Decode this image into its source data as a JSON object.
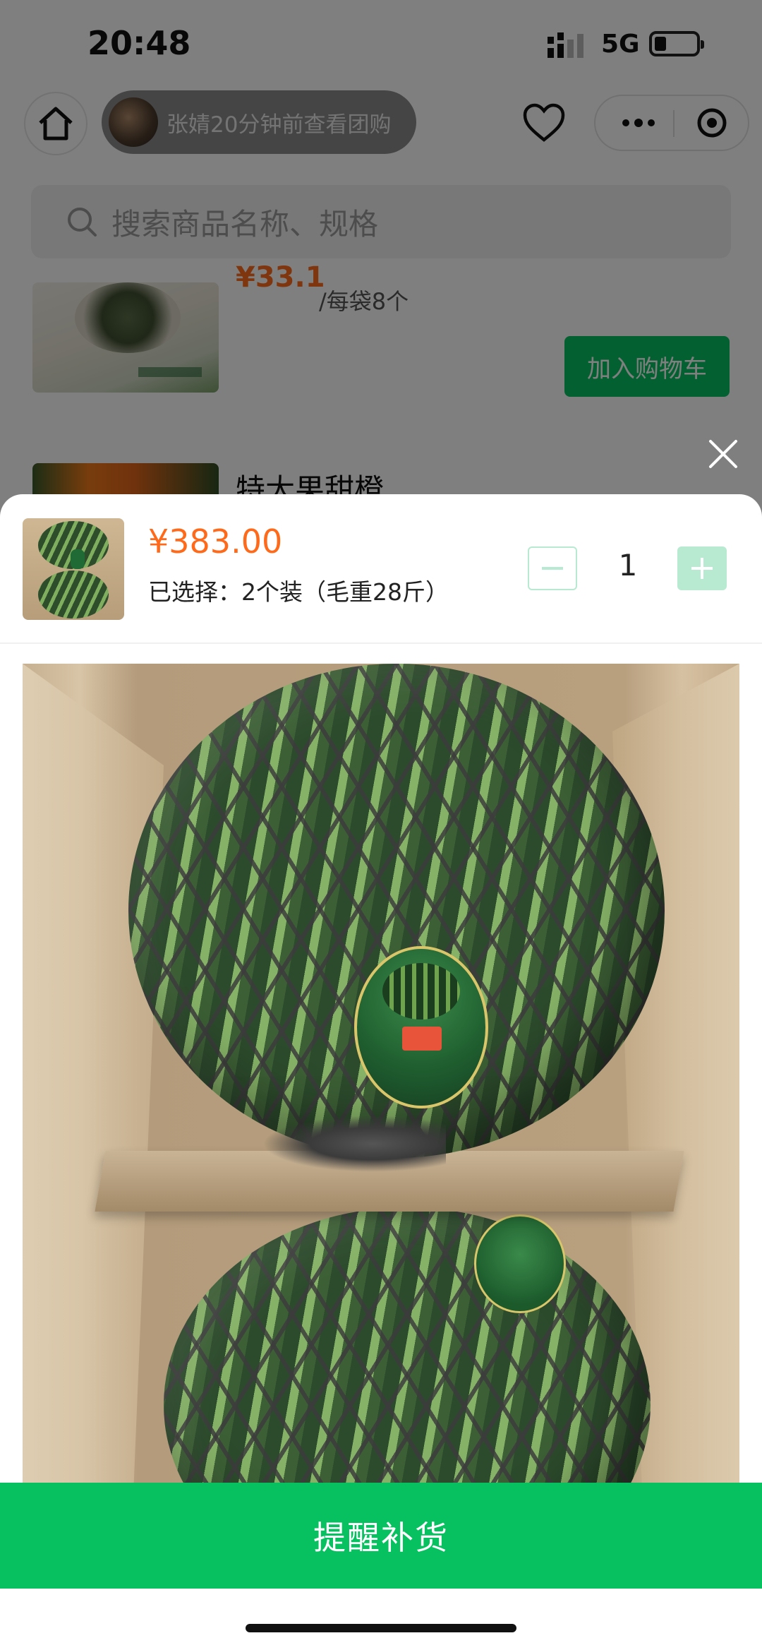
{
  "status_bar": {
    "time": "20:48",
    "network": "5G",
    "battery_level": 0.2
  },
  "nav": {
    "viewer_text": "张婧20分钟前查看团购",
    "icons": [
      "home-icon",
      "heart-icon",
      "more-icon",
      "target-icon"
    ]
  },
  "search": {
    "placeholder": "搜索商品名称、规格"
  },
  "products": [
    {
      "price_partial": "¥33.1",
      "unit": "/每袋8个",
      "cart_label": "加入购物车"
    },
    {
      "name": "特大果甜橙"
    }
  ],
  "sheet": {
    "price": "¥383.00",
    "selected": "已选择：2个装（毛重28斤）",
    "quantity": "1",
    "remind_label": "提醒补货"
  },
  "colors": {
    "accent": "#07c160",
    "price": "#ff6a1a",
    "qty_button": "#b7ead0"
  }
}
